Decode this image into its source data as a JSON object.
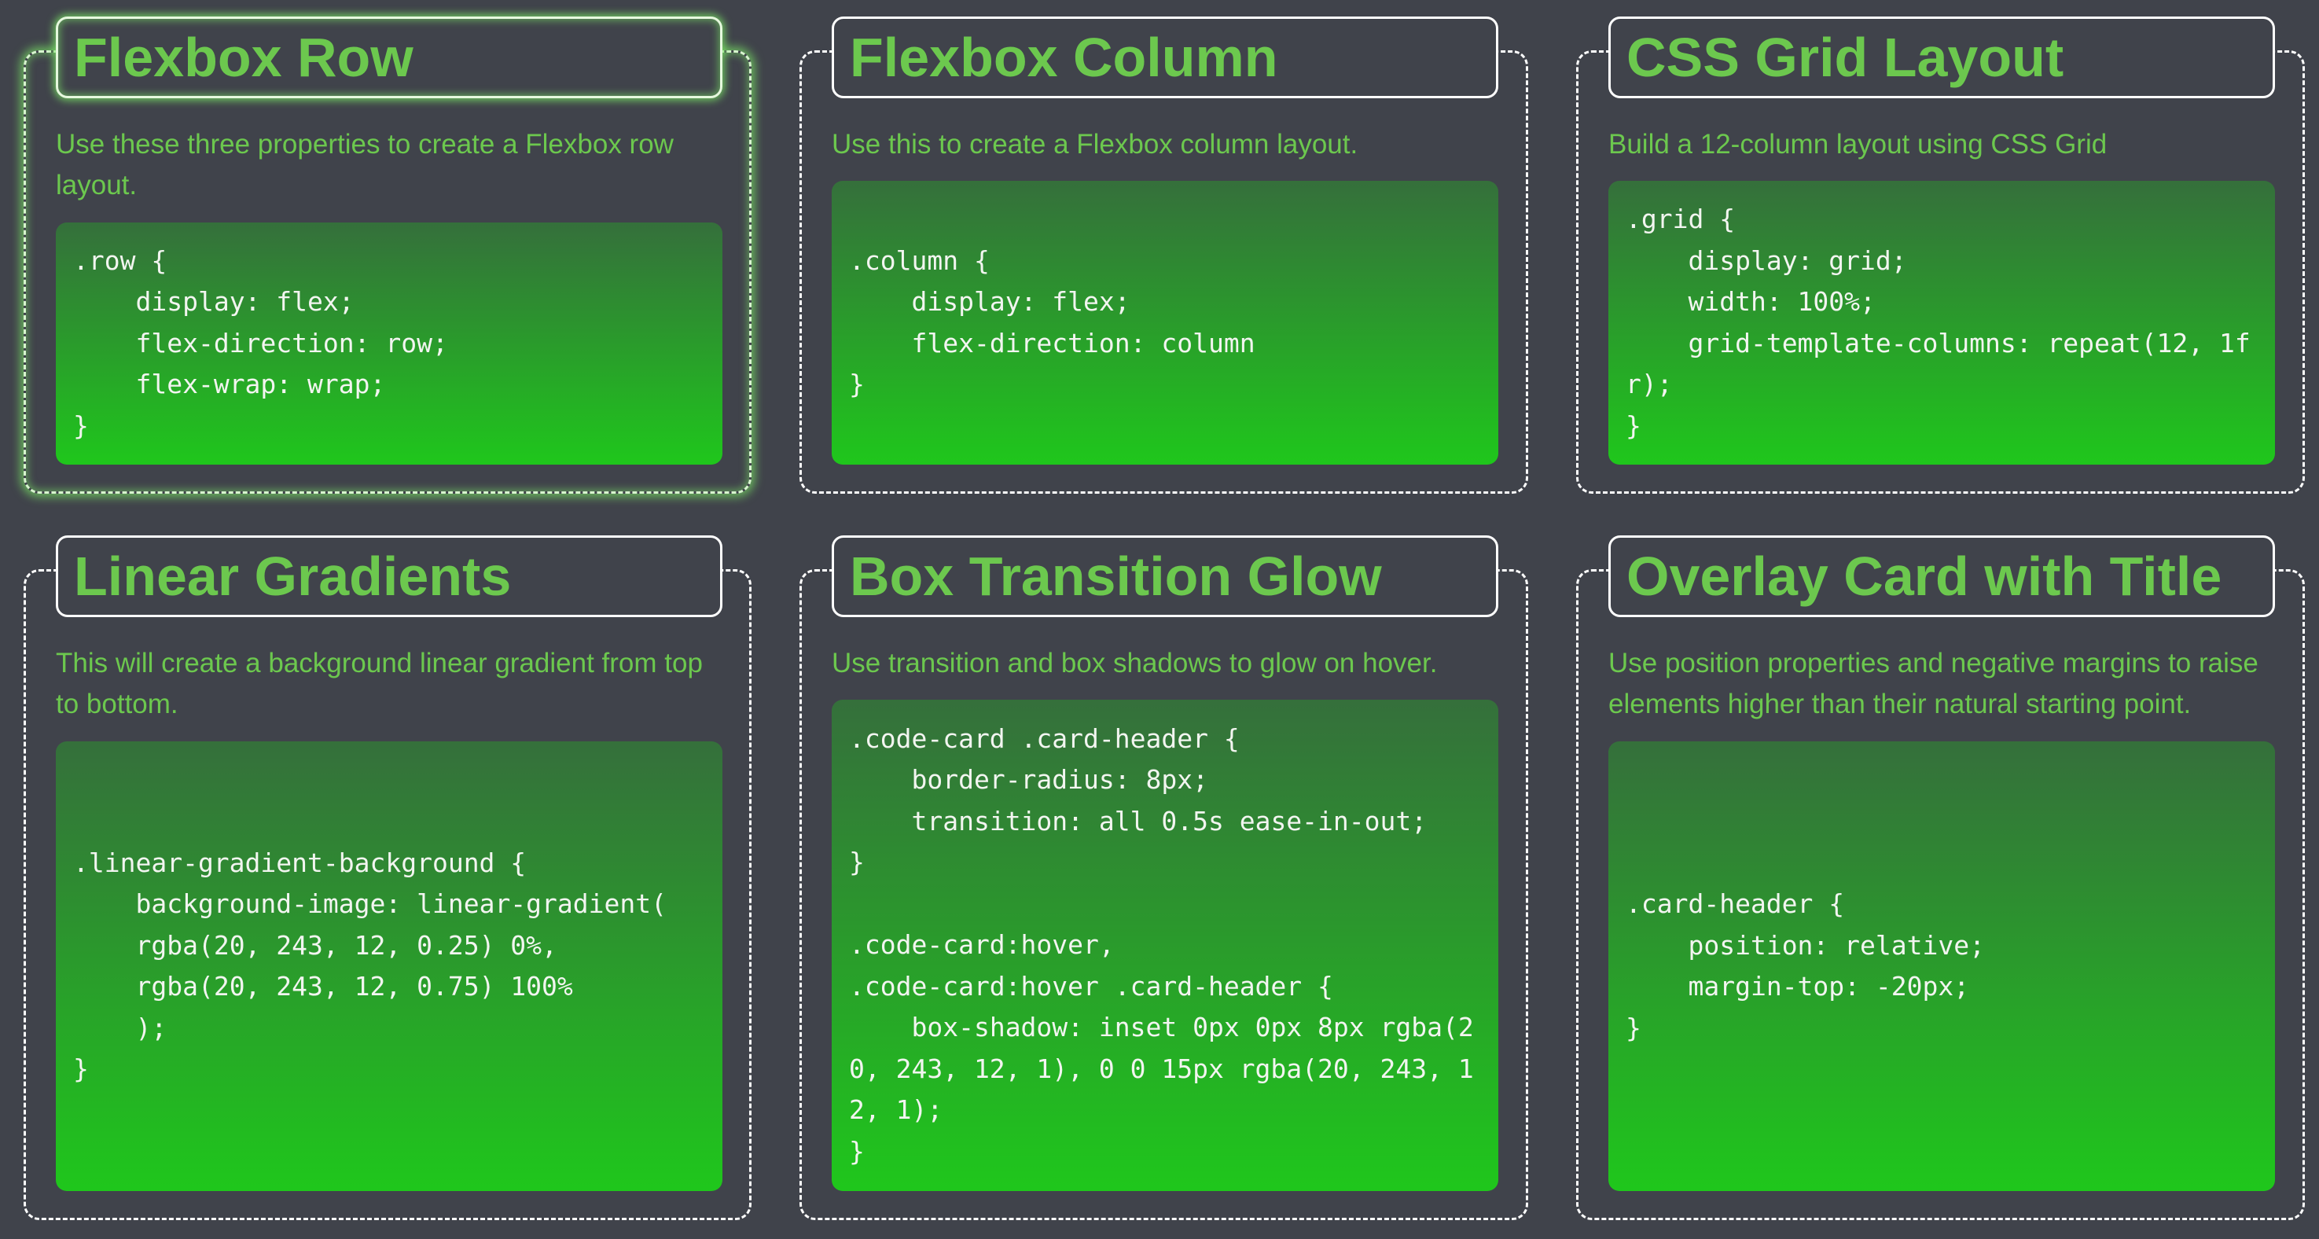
{
  "cards": [
    {
      "title": "Flexbox Row",
      "description": "Use these three properties to create a Flexbox row layout.",
      "code": ".row {\n    display: flex;\n    flex-direction: row;\n    flex-wrap: wrap;\n}"
    },
    {
      "title": "Flexbox Column",
      "description": "Use this to create a Flexbox column layout.",
      "code": ".column {\n    display: flex;\n    flex-direction: column\n}"
    },
    {
      "title": "CSS Grid Layout",
      "description": "Build a 12-column layout using CSS Grid",
      "code": ".grid {\n    display: grid;\n    width: 100%;\n    grid-template-columns: repeat(12, 1fr);\n}"
    },
    {
      "title": "Linear Gradients",
      "description": "This will create a background linear gradient from top to bottom.",
      "code": ".linear-gradient-background {\n    background-image: linear-gradient(\n    rgba(20, 243, 12, 0.25) 0%,\n    rgba(20, 243, 12, 0.75) 100%\n    );\n}"
    },
    {
      "title": "Box Transition Glow",
      "description": "Use transition and box shadows to glow on hover.",
      "code": ".code-card .card-header {\n    border-radius: 8px;\n    transition: all 0.5s ease-in-out;\n}\n\n.code-card:hover,\n.code-card:hover .card-header {\n    box-shadow: inset 0px 0px 8px rgba(20, 243, 12, 1), 0 0 15px rgba(20, 243, 12, 1);\n}"
    },
    {
      "title": "Overlay Card with Title",
      "description": "Use position properties and negative margins to raise elements higher than their natural starting point.",
      "code": ".card-header {\n    position: relative;\n    margin-top: -20px;\n}"
    }
  ],
  "colors": {
    "background": "#40434b",
    "accent_text": "#6cc84e",
    "border": "#ffffff",
    "glow": "rgba(20, 243, 12, 1)"
  }
}
